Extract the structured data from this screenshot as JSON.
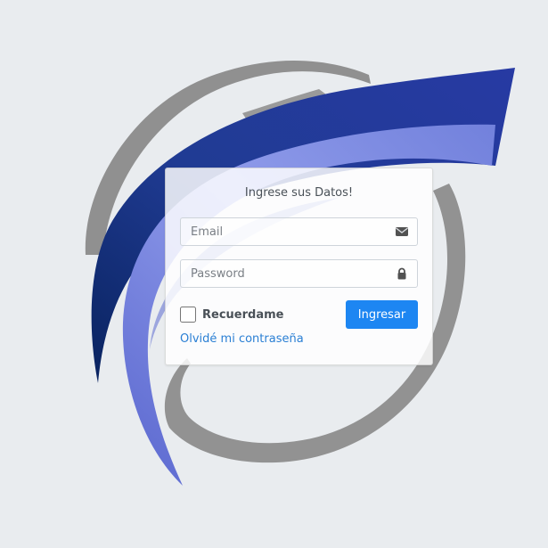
{
  "form": {
    "title": "Ingrese sus Datos!",
    "email_placeholder": "Email",
    "email_icon": "envelope-icon",
    "password_placeholder": "Password",
    "password_icon": "lock-icon",
    "remember_label": "Recuerdame",
    "remember_checked": false,
    "submit_label": "Ingresar",
    "forgot_link": "Olvidé mi contraseña"
  },
  "colors": {
    "page_background": "#e9ecef",
    "primary_button": "#1d86f2",
    "link": "#2a7fd4",
    "logo_gray": "#8e8e8e",
    "logo_dark_blue": "#243a9b",
    "logo_light_blue": "#8b97e4"
  }
}
